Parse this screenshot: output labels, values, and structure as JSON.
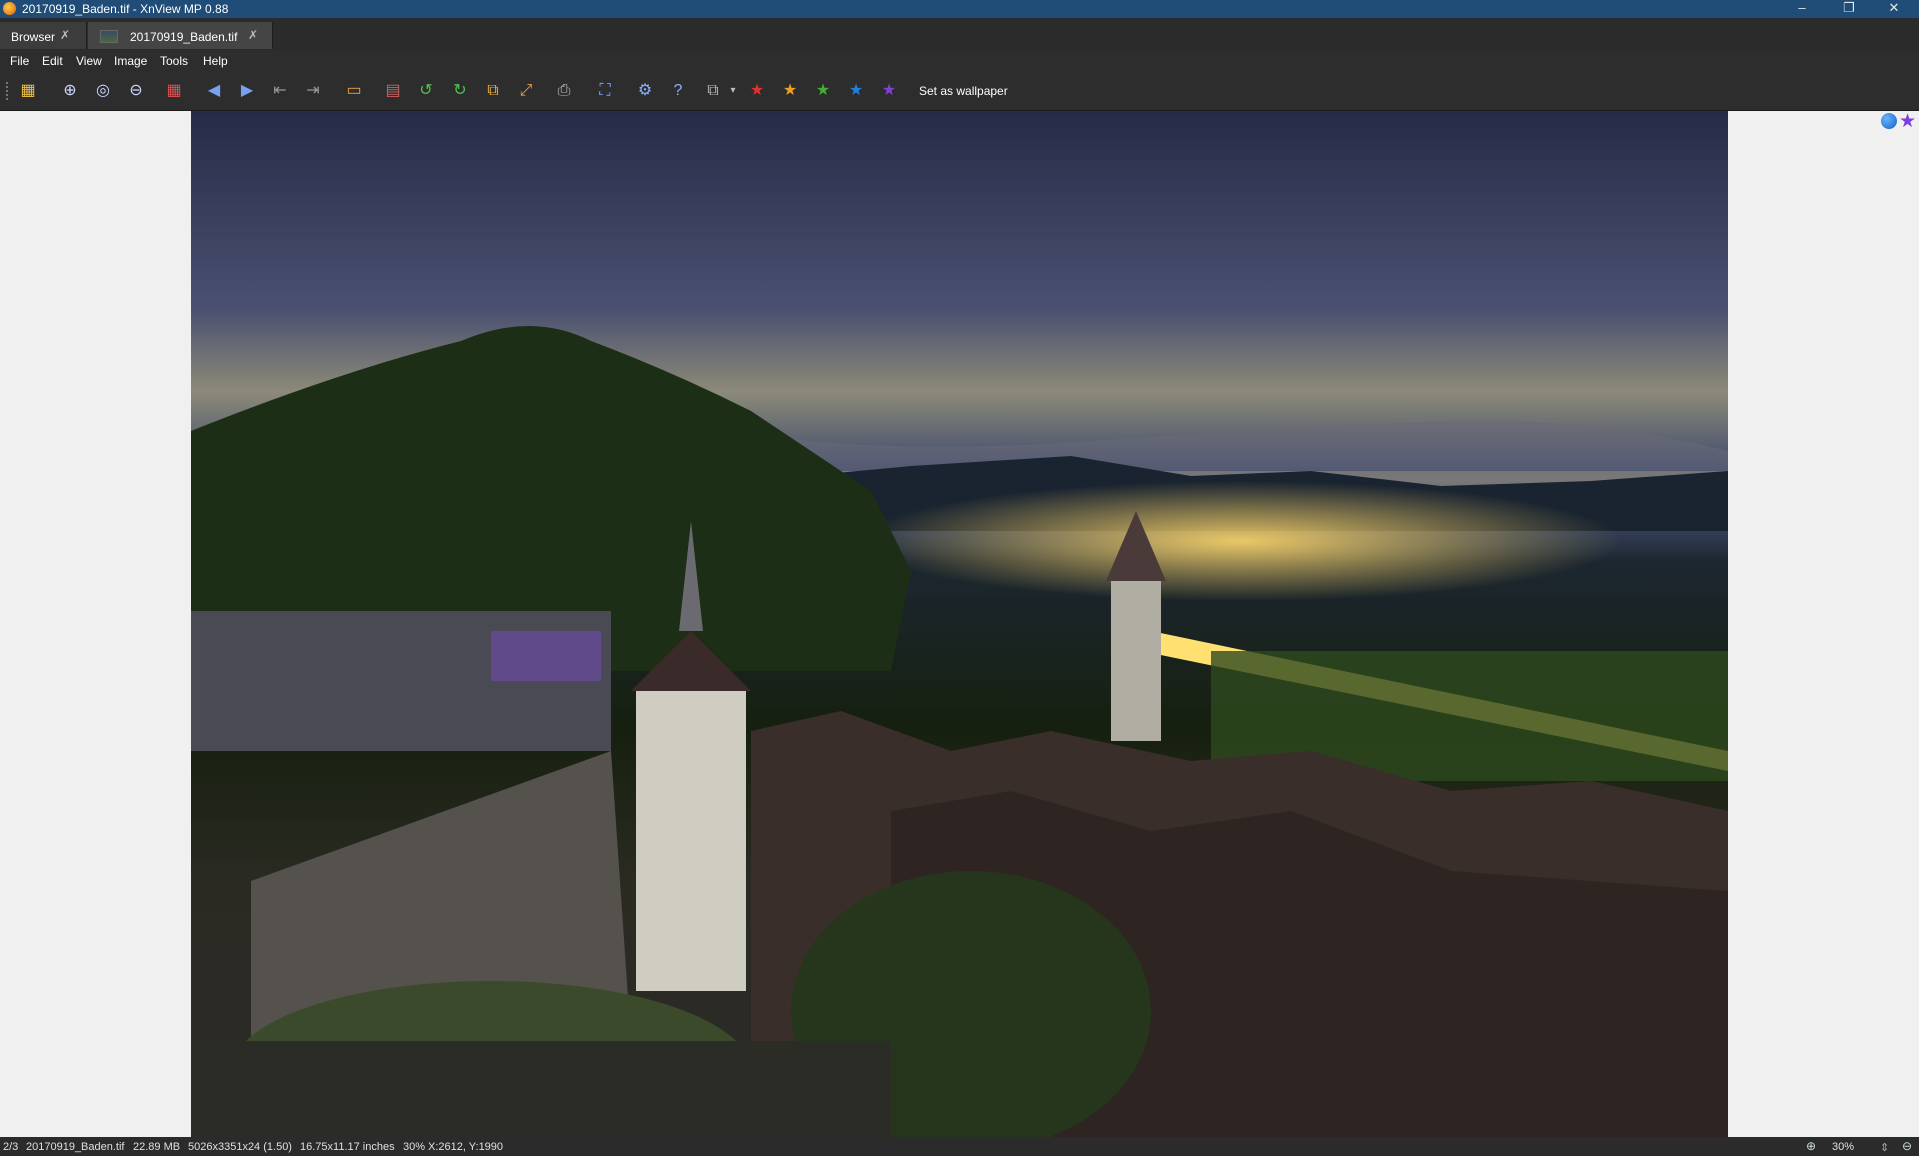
{
  "window": {
    "title": "20170919_Baden.tif - XnView MP 0.88",
    "minimize": "–",
    "maximize": "❐",
    "close": "✕"
  },
  "tabs": [
    {
      "label": "Browser",
      "pin": "✗"
    },
    {
      "label": "20170919_Baden.tif",
      "pin": "✗"
    }
  ],
  "menu": [
    "File",
    "Edit",
    "View",
    "Image",
    "Tools",
    "Help"
  ],
  "toolbar": {
    "wallpaper": "Set as wallpaper",
    "icons": [
      "browser-icon",
      "zoom-in-icon",
      "zoom-fit-icon",
      "zoom-out-icon",
      "grid-icon",
      "previous-arrow-icon",
      "next-arrow-icon",
      "first-page-icon",
      "last-page-icon",
      "slideshow-icon",
      "filmstrip-icon",
      "rotate-left-icon",
      "rotate-right-icon",
      "crop-icon",
      "resize-icon",
      "print-icon",
      "fullscreen-icon",
      "settings-gear-icon",
      "help-icon",
      "share-icon",
      "star-1-icon",
      "star-2-icon",
      "star-3-icon",
      "star-4-icon",
      "star-5-icon"
    ],
    "star_colors": [
      "#e03030",
      "#f0a020",
      "#40b030",
      "#2080e0",
      "#8040d0"
    ]
  },
  "status": {
    "index": "2/3",
    "filename": "20170919_Baden.tif",
    "filesize": "22.89 MB",
    "dimensions": "5026x3351x24 (1.50)",
    "print_size": "16.75x11.17 inches",
    "zoom": "30%",
    "cursor": "X:2612, Y:1990",
    "zoom_right": "30%"
  }
}
